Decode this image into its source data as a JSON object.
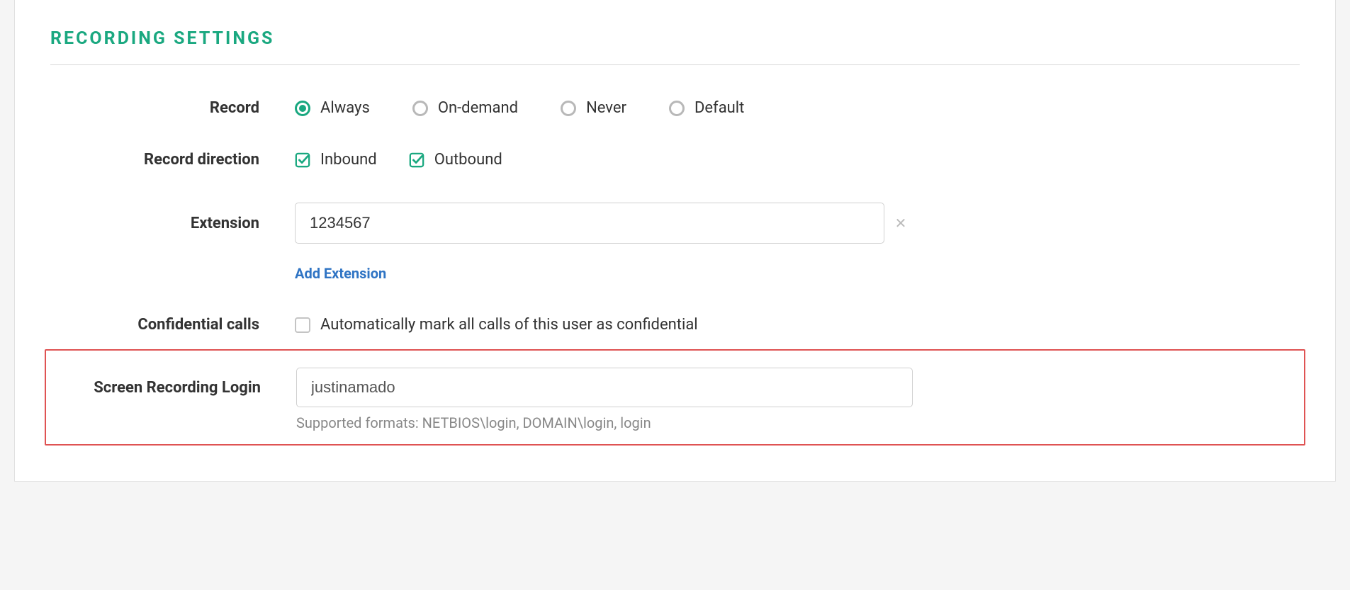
{
  "section": {
    "title": "RECORDING SETTINGS"
  },
  "record": {
    "label": "Record",
    "options": {
      "always": "Always",
      "on_demand": "On-demand",
      "never": "Never",
      "default": "Default"
    },
    "selected": "always"
  },
  "record_direction": {
    "label": "Record direction",
    "inbound_label": "Inbound",
    "outbound_label": "Outbound",
    "inbound_checked": true,
    "outbound_checked": true
  },
  "extension": {
    "label": "Extension",
    "value": "1234567",
    "add_link": "Add Extension"
  },
  "confidential": {
    "label": "Confidential calls",
    "checkbox_label": "Automatically mark all calls of this user as confidential",
    "checked": false
  },
  "screen_recording": {
    "label": "Screen Recording Login",
    "value": "justinamado",
    "hint": "Supported formats: NETBIOS\\login, DOMAIN\\login, login"
  }
}
